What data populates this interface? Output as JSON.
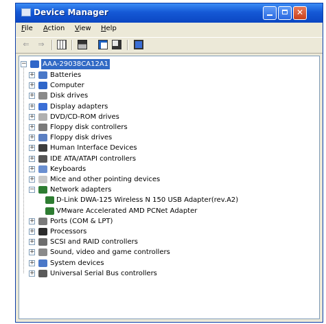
{
  "window": {
    "title": "Device Manager"
  },
  "menu": [
    "File",
    "Action",
    "View",
    "Help"
  ],
  "toolbar": {
    "buttons": [
      "back-arrow-icon",
      "forward-arrow-icon",
      "grid-view-icon",
      "printer-icon",
      "properties-icon",
      "scan-hardware-icon",
      "monitor-icon"
    ]
  },
  "tree": {
    "root": "AAA-29038CA12A1",
    "items": [
      {
        "label": "Batteries",
        "icon": "battery-icon",
        "color": "#4a78c8",
        "expander": "+"
      },
      {
        "label": "Computer",
        "icon": "computer-icon",
        "color": "#2f66c9",
        "expander": "+"
      },
      {
        "label": "Disk drives",
        "icon": "disk-drive-icon",
        "color": "#8a8a8a",
        "expander": "+"
      },
      {
        "label": "Display adapters",
        "icon": "display-adapter-icon",
        "color": "#3a6ed6",
        "expander": "+"
      },
      {
        "label": "DVD/CD-ROM drives",
        "icon": "dvd-drive-icon",
        "color": "#b0b0b0",
        "expander": "+"
      },
      {
        "label": "Floppy disk controllers",
        "icon": "floppy-controller-icon",
        "color": "#7a7a7a",
        "expander": "+"
      },
      {
        "label": "Floppy disk drives",
        "icon": "floppy-drive-icon",
        "color": "#5b7fc2",
        "expander": "+"
      },
      {
        "label": "Human Interface Devices",
        "icon": "hid-icon",
        "color": "#3d3d3d",
        "expander": "+"
      },
      {
        "label": "IDE ATA/ATAPI controllers",
        "icon": "ide-controller-icon",
        "color": "#555555",
        "expander": "+"
      },
      {
        "label": "Keyboards",
        "icon": "keyboard-icon",
        "color": "#6a8fd0",
        "expander": "+"
      },
      {
        "label": "Mice and other pointing devices",
        "icon": "mouse-icon",
        "color": "#c8c8c8",
        "expander": "+"
      },
      {
        "label": "Network adapters",
        "icon": "network-adapter-icon",
        "color": "#2e7d32",
        "expander": "-"
      },
      {
        "label": "D-Link DWA-125 Wireless N 150 USB Adapter(rev.A2)",
        "icon": "network-card-icon",
        "color": "#2e7d32",
        "child": true
      },
      {
        "label": "VMware Accelerated AMD PCNet Adapter",
        "icon": "network-card-icon",
        "color": "#2e7d32",
        "child": true
      },
      {
        "label": "Ports (COM & LPT)",
        "icon": "port-icon",
        "color": "#7a7a7a",
        "expander": "+"
      },
      {
        "label": "Processors",
        "icon": "processor-icon",
        "color": "#2b2b2b",
        "expander": "+"
      },
      {
        "label": "SCSI and RAID controllers",
        "icon": "scsi-controller-icon",
        "color": "#6d6d6d",
        "expander": "+"
      },
      {
        "label": "Sound, video and game controllers",
        "icon": "sound-icon",
        "color": "#8a8a8a",
        "expander": "+"
      },
      {
        "label": "System devices",
        "icon": "system-device-icon",
        "color": "#4a78c8",
        "expander": "+"
      },
      {
        "label": "Universal Serial Bus controllers",
        "icon": "usb-icon",
        "color": "#5a5a5a",
        "expander": "+"
      }
    ]
  }
}
